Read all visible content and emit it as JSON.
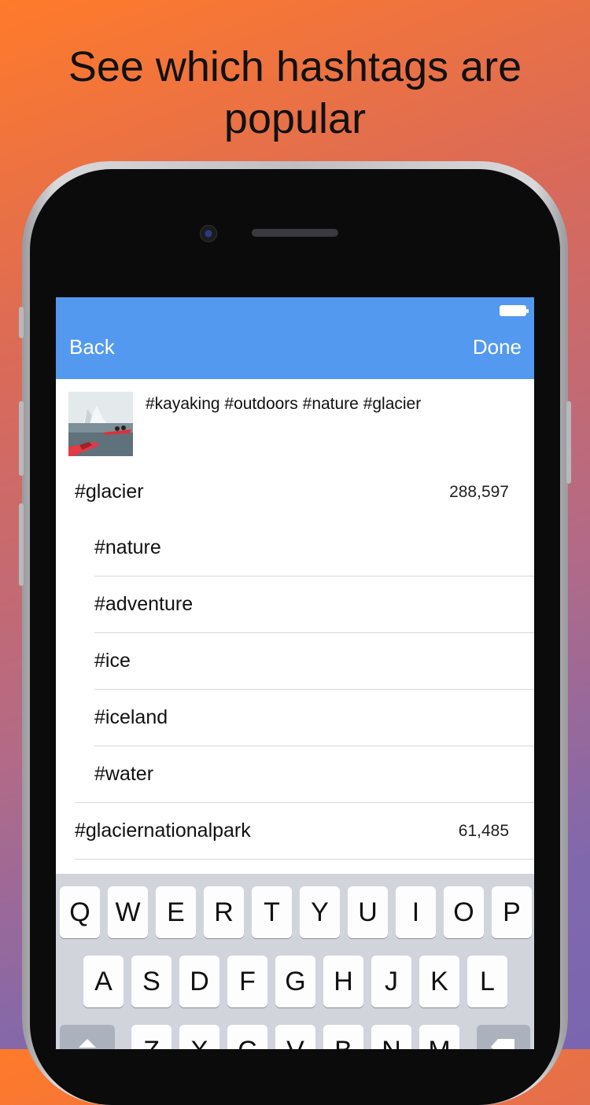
{
  "headline": "See which hashtags are popular",
  "nav": {
    "back_label": "Back",
    "done_label": "Done"
  },
  "post": {
    "caption": "#kayaking #outdoors #nature #glacier"
  },
  "hashtags": [
    {
      "tag": "#glacier",
      "count": "288,597",
      "level": "main"
    },
    {
      "tag": "#nature",
      "count": "",
      "level": "sub"
    },
    {
      "tag": "#adventure",
      "count": "",
      "level": "sub"
    },
    {
      "tag": "#ice",
      "count": "",
      "level": "sub"
    },
    {
      "tag": "#iceland",
      "count": "",
      "level": "sub"
    },
    {
      "tag": "#water",
      "count": "",
      "level": "sub"
    },
    {
      "tag": "#glaciernationalpark",
      "count": "61,485",
      "level": "main"
    }
  ],
  "keyboard": {
    "row1": [
      "Q",
      "W",
      "E",
      "R",
      "T",
      "Y",
      "U",
      "I",
      "O",
      "P"
    ],
    "row2": [
      "A",
      "S",
      "D",
      "F",
      "G",
      "H",
      "J",
      "K",
      "L"
    ],
    "row3": [
      "Z",
      "X",
      "C",
      "V",
      "B",
      "N",
      "M"
    ]
  },
  "colors": {
    "navbar": "#5399ef",
    "accent_orange": "#ff7a2a",
    "accent_purple": "#7a66b0"
  }
}
